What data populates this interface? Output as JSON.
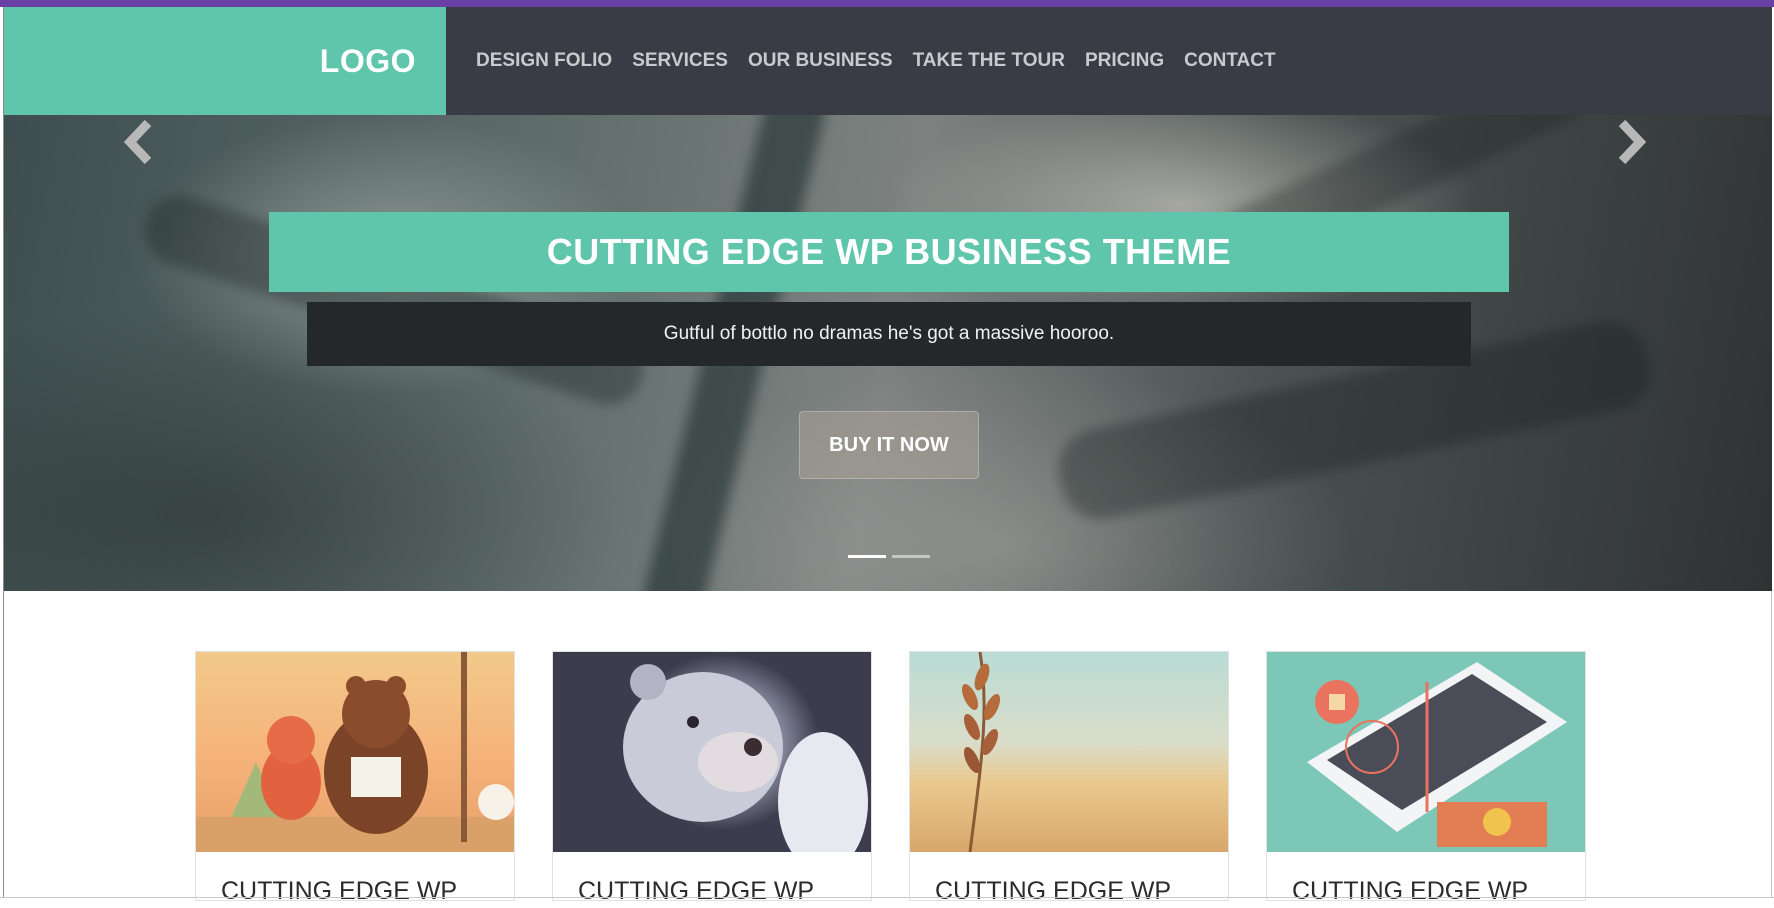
{
  "header": {
    "logo": "LOGO",
    "nav": [
      "DESIGN FOLIO",
      "SERVICES",
      "OUR BUSINESS",
      "TAKE THE TOUR",
      "PRICING",
      "CONTACT"
    ]
  },
  "hero": {
    "title": "CUTTING EDGE WP BUSINESS THEME",
    "subtitle": "Gutful of bottlo no dramas he's got a massive hooroo.",
    "button": "BUY IT NOW",
    "prev_icon": "chevron-left-icon",
    "next_icon": "chevron-right-icon",
    "slide_count": 2,
    "active_slide": 1
  },
  "cards": [
    {
      "title": "CUTTING EDGE WP"
    },
    {
      "title": "CUTTING EDGE WP"
    },
    {
      "title": "CUTTING EDGE WP"
    },
    {
      "title": "CUTTING EDGE WP"
    }
  ],
  "colors": {
    "accent": "#5fc5ab",
    "header_bg": "#393c45",
    "top_bar": "#6a3fa6",
    "subtitle_band": "#24282b"
  }
}
